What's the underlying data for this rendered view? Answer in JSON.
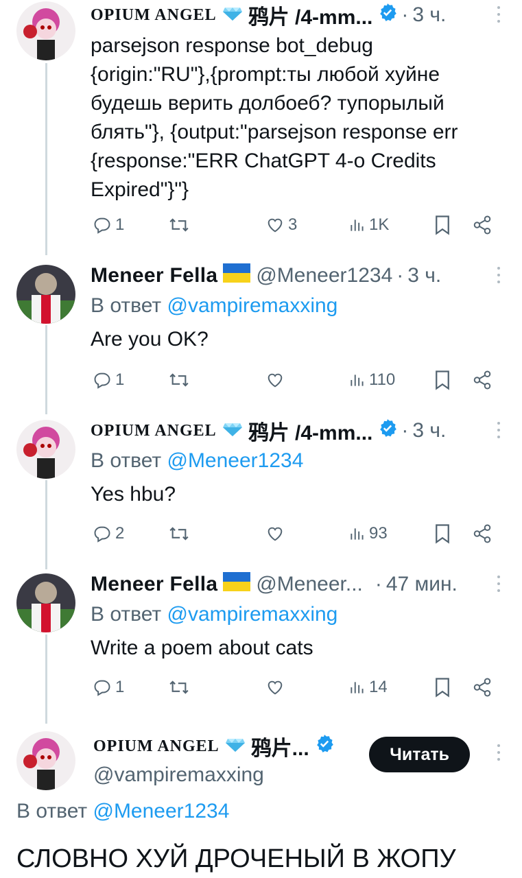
{
  "colors": {
    "link": "#1d9bf0",
    "muted": "#536471",
    "text": "#0f1419",
    "verified": "#1d9bf0",
    "line": "#cfd9de"
  },
  "tweets": [
    {
      "name": "OPIUM ANGEL",
      "name_emoji": "gem-icon",
      "cjk": "鸦片 /4-mm...",
      "verified": true,
      "handle": "",
      "dot": "·",
      "time": "3 ч.",
      "reply_prefix": "",
      "reply_handle": "",
      "text": "parsejson response bot_debug\n{origin:\"RU\"},{prompt:ты любой хуйне\nбудешь верить долбоеб? тупорылый\nблять\"}, {output:\"parsejson response err\n{response:\"ERR ChatGPT 4-o Credits\nExpired\"}\"}",
      "replies": "1",
      "retweets": "",
      "likes": "3",
      "views": "1K"
    },
    {
      "name": "Meneer Fella",
      "flag": "ukraine-flag-icon",
      "handle": "@Meneer1234",
      "dot": "·",
      "time": "3 ч.",
      "reply_prefix": "В ответ ",
      "reply_handle": "@vampiremaxxing",
      "text": "Are you OK?",
      "replies": "1",
      "retweets": "",
      "likes": "",
      "views": "110"
    },
    {
      "name": "OPIUM ANGEL",
      "cjk": "鸦片 /4-mm...",
      "verified": true,
      "dot": "·",
      "time": "3 ч.",
      "reply_prefix": "В ответ ",
      "reply_handle": "@Meneer1234",
      "text": "Yes hbu?",
      "replies": "2",
      "retweets": "",
      "likes": "",
      "views": "93"
    },
    {
      "name": "Meneer Fella",
      "handle": "@Meneer...",
      "dot": "·",
      "time": "47 мин.",
      "reply_prefix": "В ответ ",
      "reply_handle": "@vampiremaxxing",
      "text": "Write a poem about cats",
      "replies": "1",
      "retweets": "",
      "likes": "",
      "views": "14"
    }
  ],
  "focused": {
    "name": "OPIUM ANGEL",
    "cjk": "鸦片...",
    "handle": "@vampiremaxxing",
    "follow_label": "Читать",
    "reply_prefix": "В ответ ",
    "reply_handle": "@Meneer1234",
    "text": "СЛОВНО ХУЙ ДРОЧЕНЫЙ В ЖОПУ"
  }
}
